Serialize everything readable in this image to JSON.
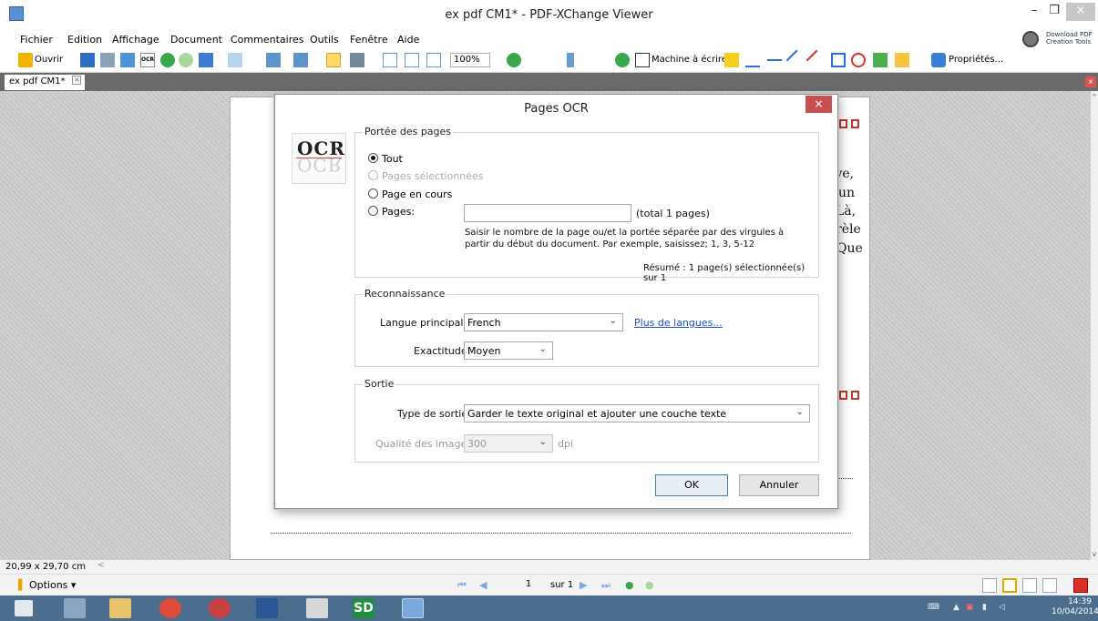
{
  "window": {
    "title": "ex pdf CM1* - PDF-XChange Viewer",
    "minimize": "–",
    "maximize": "❐",
    "close": "×"
  },
  "menu": [
    "Fichier",
    "Edition",
    "Affichage",
    "Document",
    "Commentaires",
    "Outils",
    "Fenêtre",
    "Aide"
  ],
  "download_pdf": {
    "line1": "Download PDF",
    "line2": "Creation Tools"
  },
  "toolbar": {
    "open_label": "Ouvrir",
    "ocr_label": "OCR",
    "zoom_value": "100%",
    "typewriter_label": "Machine à écrire",
    "properties_label": "Propriétés..."
  },
  "tab": {
    "label": "ex pdf CM1*",
    "close": "×"
  },
  "page_fragments": [
    "ive,",
    "un",
    "Là,",
    "rèle",
    "Que"
  ],
  "dialog": {
    "title": "Pages OCR",
    "close": "×",
    "logo_text": "OCR",
    "page_range": {
      "label": "Portée des pages",
      "options": [
        "Tout",
        "Pages sélectionnées",
        "Page en cours",
        "Pages:"
      ],
      "selected": "Tout",
      "pages_input_value": "",
      "total_text": "(total 1 pages)",
      "hint": "Saisir le nombre de la page ou/et la portée séparée par des virgules à partir du début du document. Par exemple, saisissez; 1, 3, 5-12",
      "summary": "Résumé : 1 page(s) sélectionnée(s) sur 1"
    },
    "recognition": {
      "label": "Reconnaissance",
      "language_label": "Langue principale:",
      "language_value": "French",
      "more_languages": "Plus de langues...",
      "accuracy_label": "Exactitude:",
      "accuracy_value": "Moyen"
    },
    "output": {
      "label": "Sortie",
      "type_label": "Type de sortie:",
      "type_value": "Garder le texte original et ajouter une couche texte",
      "quality_label": "Qualité des images:",
      "quality_value": "300",
      "quality_unit": "dpi"
    },
    "ok": "OK",
    "cancel": "Annuler"
  },
  "status": {
    "page_size": "20,99 x 29,70 cm"
  },
  "nav": {
    "options_label": "Options",
    "current_page": "1",
    "page_of": "sur 1"
  },
  "taskbar": {
    "clock_time": "14:39",
    "clock_date": "10/04/2014",
    "apps": [
      "start",
      "calculator",
      "file-explorer",
      "chrome",
      "snipping-tool",
      "word",
      "notes",
      "sd",
      "pdf-xchange"
    ],
    "sd_label": "SD"
  }
}
